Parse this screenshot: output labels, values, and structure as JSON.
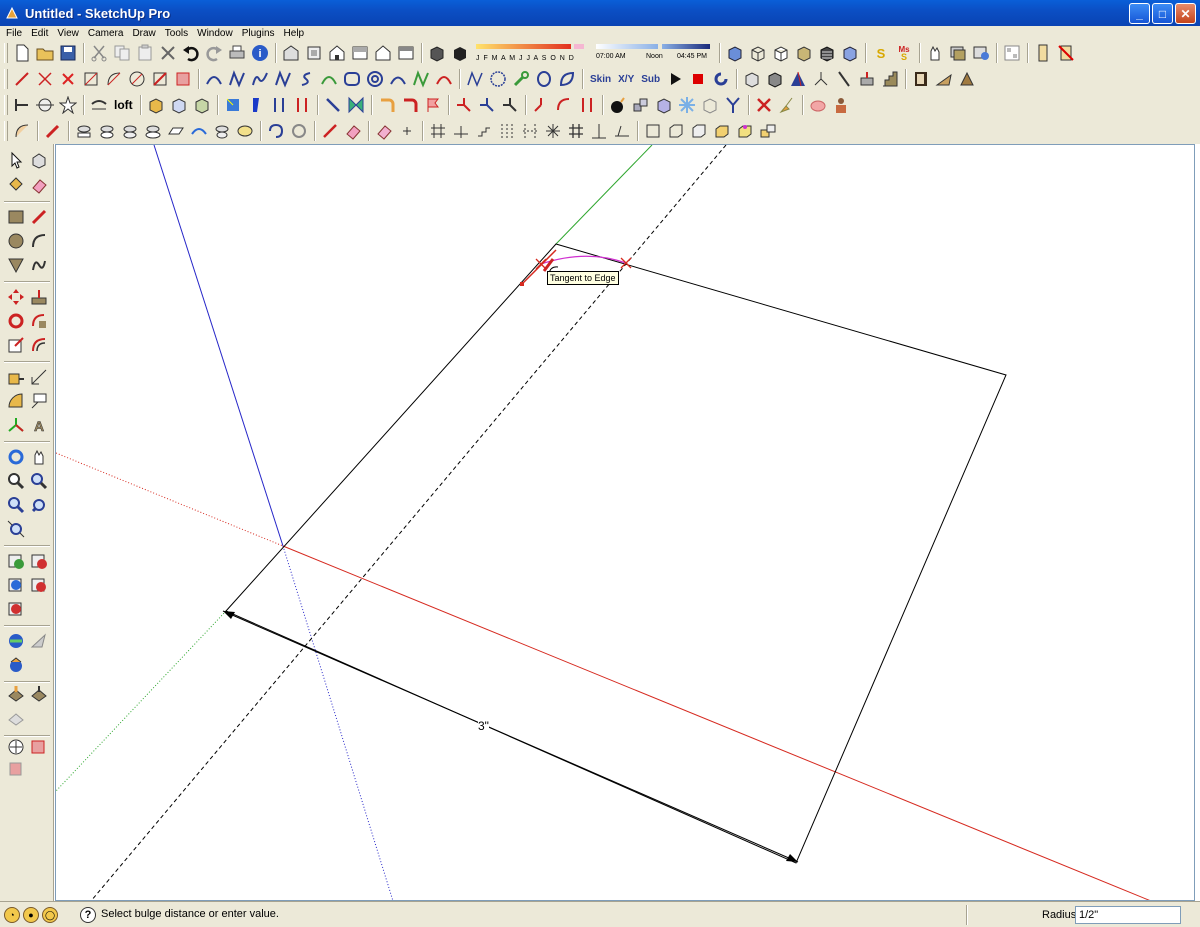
{
  "window": {
    "title": "Untitled - SketchUp Pro"
  },
  "menu": [
    "File",
    "Edit",
    "View",
    "Camera",
    "Draw",
    "Tools",
    "Window",
    "Plugins",
    "Help"
  ],
  "toolbar": {
    "loft_label": "loft",
    "skin_label": "Skin",
    "xy_label": "X/Y",
    "sub_label": "Sub"
  },
  "shadows": {
    "months": "J F M A M J J A S O N D",
    "time_start": "07:00 AM",
    "time_mid": "Noon",
    "time_end": "04:45 PM"
  },
  "viewport": {
    "tooltip": "Tangent to Edge",
    "dimension": "3\""
  },
  "status": {
    "message": "Select bulge distance or enter value.",
    "vcb_label": "Radius",
    "vcb_value": "1/2\""
  },
  "colors": {
    "axis_red": "#d62a20",
    "axis_green": "#2ea62e",
    "axis_blue": "#2626c8",
    "arc_preview": "#d030d0"
  }
}
